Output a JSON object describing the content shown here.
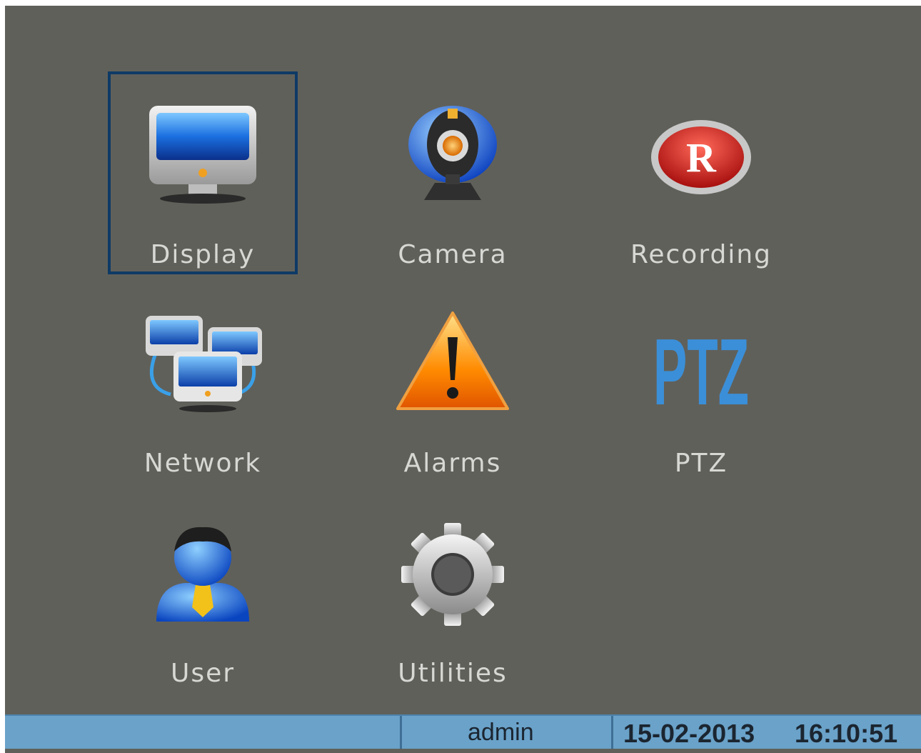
{
  "menu": {
    "items": [
      {
        "label": "Display",
        "icon": "monitor-icon",
        "selected": true
      },
      {
        "label": "Camera",
        "icon": "webcam-icon",
        "selected": false
      },
      {
        "label": "Recording",
        "icon": "record-icon",
        "selected": false
      },
      {
        "label": "Network",
        "icon": "network-icon",
        "selected": false
      },
      {
        "label": "Alarms",
        "icon": "warning-icon",
        "selected": false
      },
      {
        "label": "PTZ",
        "icon": "ptz-icon",
        "selected": false
      },
      {
        "label": "User",
        "icon": "user-icon",
        "selected": false
      },
      {
        "label": "Utilities",
        "icon": "gear-icon",
        "selected": false
      }
    ]
  },
  "ptz_icon_text": "PTZ",
  "record_icon_text": "R",
  "status": {
    "user": "admin",
    "date": "15-02-2013",
    "time": "16:10:51"
  },
  "colors": {
    "background": "#60605a",
    "selection_border": "#0e3a66",
    "status_bar": "#6aa2c9",
    "label_text": "#d7d7d4"
  }
}
